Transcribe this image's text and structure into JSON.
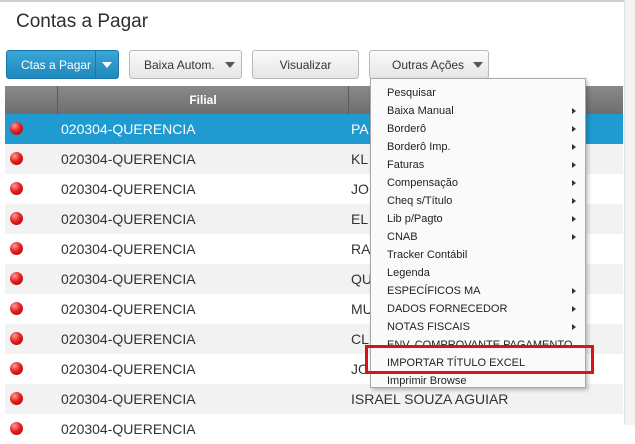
{
  "page": {
    "title": "Contas a Pagar"
  },
  "toolbar": {
    "ctas_label": "Ctas a Pagar",
    "baixa_label": "Baixa Autom.",
    "visualizar_label": "Visualizar",
    "outras_label": "Outras Ações"
  },
  "grid": {
    "header_filial": "Filial",
    "rows": [
      {
        "filial": "020304-QUERENCIA",
        "name": "PA"
      },
      {
        "filial": "020304-QUERENCIA",
        "name": "KL"
      },
      {
        "filial": "020304-QUERENCIA",
        "name": "JO"
      },
      {
        "filial": "020304-QUERENCIA",
        "name": "EL"
      },
      {
        "filial": "020304-QUERENCIA",
        "name": "RA"
      },
      {
        "filial": "020304-QUERENCIA",
        "name": "QU"
      },
      {
        "filial": "020304-QUERENCIA",
        "name": "MU"
      },
      {
        "filial": "020304-QUERENCIA",
        "name": "CL"
      },
      {
        "filial": "020304-QUERENCIA",
        "name": "JO"
      },
      {
        "filial": "020304-QUERENCIA",
        "name": "ISRAEL SOUZA AGUIAR"
      },
      {
        "filial": "020304-QUERENCIA",
        "name": ""
      }
    ]
  },
  "menu": {
    "items": [
      {
        "label": "Pesquisar",
        "submenu": false
      },
      {
        "label": "Baixa Manual",
        "submenu": true
      },
      {
        "label": "Borderô",
        "submenu": true
      },
      {
        "label": "Borderô Imp.",
        "submenu": true
      },
      {
        "label": "Faturas",
        "submenu": true
      },
      {
        "label": "Compensação",
        "submenu": true
      },
      {
        "label": "Cheq s/Título",
        "submenu": true
      },
      {
        "label": "Lib p/Pagto",
        "submenu": true
      },
      {
        "label": "CNAB",
        "submenu": true
      },
      {
        "label": "Tracker Contábil",
        "submenu": false
      },
      {
        "label": "Legenda",
        "submenu": false
      },
      {
        "label": "ESPECÍFICOS MA",
        "submenu": true
      },
      {
        "label": "DADOS FORNECEDOR",
        "submenu": true
      },
      {
        "label": "NOTAS FISCAIS",
        "submenu": true
      },
      {
        "label": "ENV. COMPROVANTE PAGAMENTO",
        "submenu": false
      },
      {
        "label": "IMPORTAR TÍTULO EXCEL",
        "submenu": false
      },
      {
        "label": "Imprimir Browse",
        "submenu": false
      }
    ]
  },
  "colors": {
    "primary_button": "#1f87bd",
    "selected_row": "#1f9bd1",
    "highlight_box": "#d8131b",
    "status_dot": "#e42222"
  }
}
